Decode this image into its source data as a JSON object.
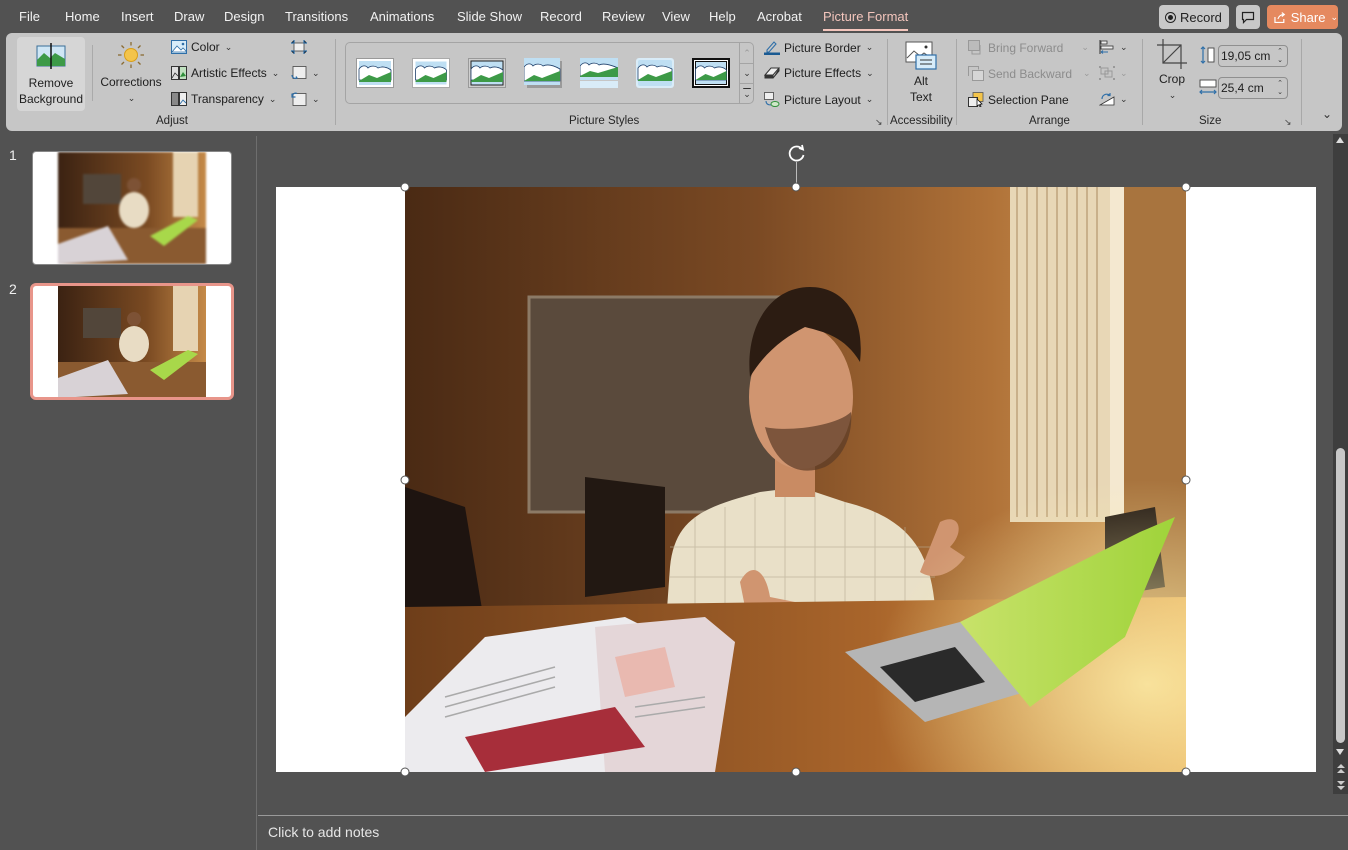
{
  "tabs": [
    {
      "label": "File",
      "active": false
    },
    {
      "label": "Home",
      "active": false
    },
    {
      "label": "Insert",
      "active": false
    },
    {
      "label": "Draw",
      "active": false
    },
    {
      "label": "Design",
      "active": false
    },
    {
      "label": "Transitions",
      "active": false
    },
    {
      "label": "Animations",
      "active": false
    },
    {
      "label": "Slide Show",
      "active": false
    },
    {
      "label": "Record",
      "active": false
    },
    {
      "label": "Review",
      "active": false
    },
    {
      "label": "View",
      "active": false
    },
    {
      "label": "Help",
      "active": false
    },
    {
      "label": "Acrobat",
      "active": false
    },
    {
      "label": "Picture Format",
      "active": true
    }
  ],
  "topbar": {
    "record_label": "Record",
    "comment_icon": "comment-icon",
    "share_label": "Share",
    "share_color": "#e5895f"
  },
  "ribbon": {
    "adjust": {
      "group_label": "Adjust",
      "remove_background_line1": "Remove",
      "remove_background_line2": "Background",
      "corrections_label": "Corrections",
      "color_label": "Color",
      "artistic_effects_label": "Artistic Effects",
      "transparency_label": "Transparency",
      "compress_icon": "compress-pictures-icon",
      "change_picture_icon": "change-picture-icon",
      "reset_picture_icon": "reset-picture-icon"
    },
    "picture_styles": {
      "group_label": "Picture Styles",
      "styles": [
        "Simple Frame, White",
        "Beveled Matte, White",
        "Metal Frame",
        "Drop Shadow Rectangle",
        "Reflected Rounded Rectangle",
        "Soft Edge Rectangle",
        "Double Frame, Black"
      ],
      "picture_border_label": "Picture Border",
      "picture_effects_label": "Picture Effects",
      "picture_layout_label": "Picture Layout"
    },
    "accessibility": {
      "group_label": "Accessibility",
      "alt_text_line1": "Alt",
      "alt_text_line2": "Text"
    },
    "arrange": {
      "group_label": "Arrange",
      "bring_forward_label": "Bring Forward",
      "send_backward_label": "Send Backward",
      "selection_pane_label": "Selection Pane",
      "bring_forward_enabled": false,
      "send_backward_enabled": false
    },
    "size": {
      "group_label": "Size",
      "crop_label": "Crop",
      "height_value": "19,05 cm",
      "width_value": "25,4 cm"
    }
  },
  "slides": [
    {
      "number": "1",
      "selected": false
    },
    {
      "number": "2",
      "selected": true
    }
  ],
  "notes_placeholder": "Click to add notes",
  "accent_color": "#f4c6bd",
  "selection_color": "#e8958a"
}
